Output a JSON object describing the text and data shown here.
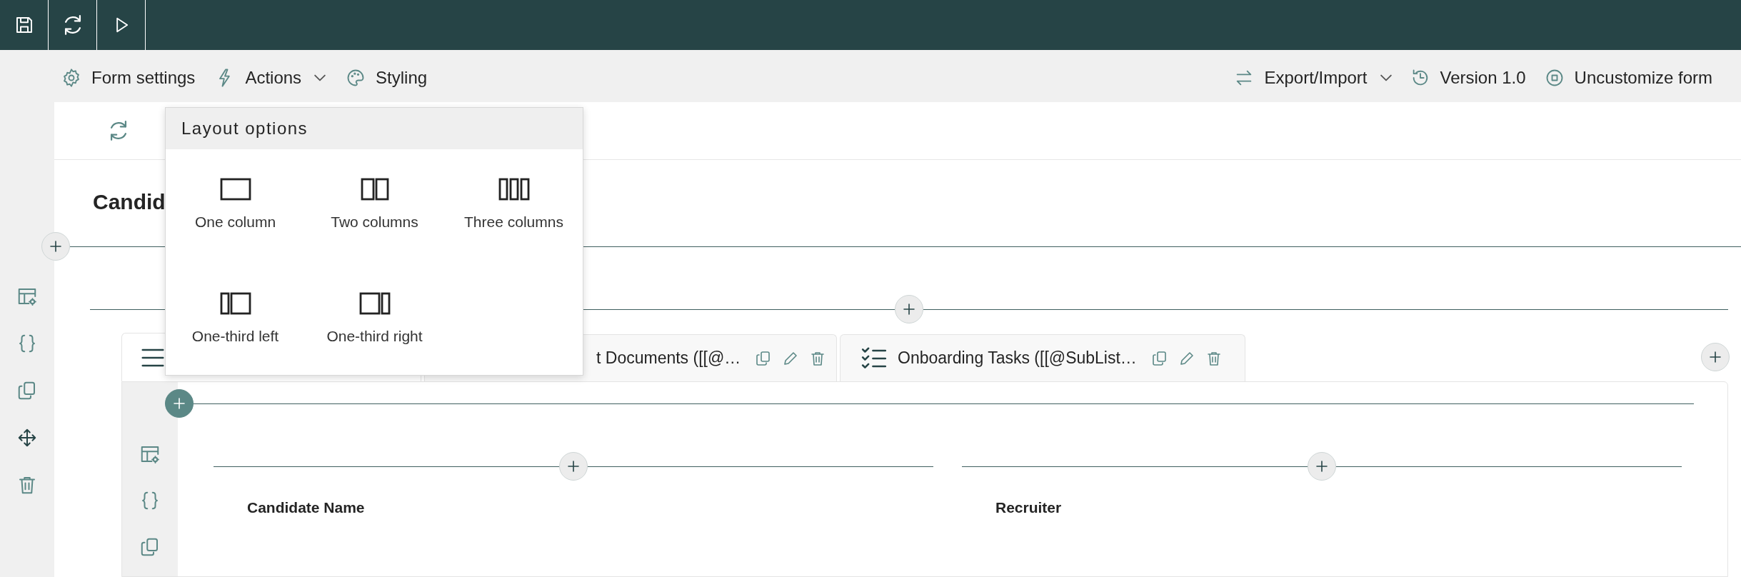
{
  "command_bar": {
    "left": [
      {
        "label": "Form settings",
        "dropdown": false
      },
      {
        "label": "Actions",
        "dropdown": true
      },
      {
        "label": "Styling",
        "dropdown": false
      }
    ],
    "right": [
      {
        "label": "Export/Import",
        "dropdown": true
      },
      {
        "label": "Version 1.0",
        "dropdown": false
      },
      {
        "label": "Uncustomize form",
        "dropdown": false
      }
    ]
  },
  "form": {
    "heading": "Candid",
    "tabs": [
      {
        "kind": "list",
        "selected": true
      },
      {
        "kind": "plain",
        "label": "t Documents ([[@…",
        "selected": false
      },
      {
        "kind": "checklist",
        "label": "Onboarding Tasks ([[@SubList…",
        "selected": false
      }
    ],
    "fields": [
      {
        "label": "Candidate Name"
      },
      {
        "label": "Recruiter"
      }
    ]
  },
  "layout_menu": {
    "title": "Layout options",
    "options": [
      {
        "kind": "single",
        "label": "One column"
      },
      {
        "kind": "double",
        "label": "Two columns"
      },
      {
        "kind": "triple",
        "label": "Three columns"
      },
      {
        "kind": "thirdleft",
        "label": "One-third left"
      },
      {
        "kind": "thirdright",
        "label": "One-third right"
      }
    ]
  }
}
